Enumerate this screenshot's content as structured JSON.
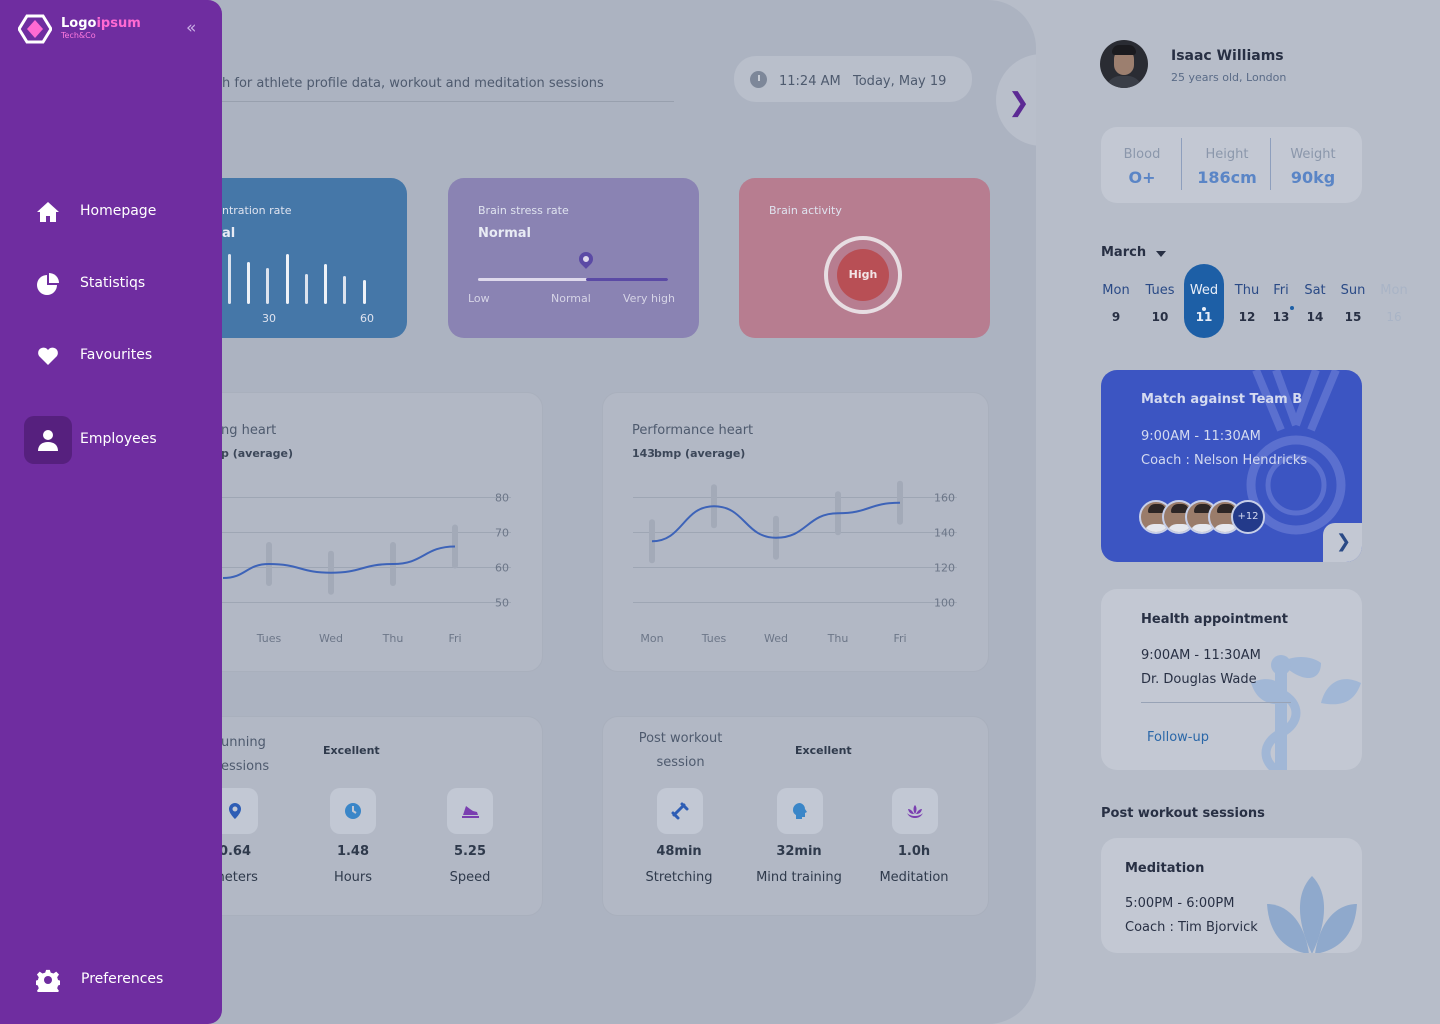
{
  "header": {
    "search_text": "h for athlete profile data, workout and meditation sessions",
    "time": "11:24 AM",
    "date": "Today, May 19"
  },
  "cards": {
    "concentration": {
      "title": "ntration rate",
      "value": "al",
      "tick_30": "30",
      "tick_60": "60"
    },
    "stress": {
      "title": "Brain stress rate",
      "value": "Normal",
      "level": 0.57,
      "low": "Low",
      "normal": "Normal",
      "high": "Very high"
    },
    "activity": {
      "title": "Brain activity",
      "value": "High"
    }
  },
  "resting_chart": {
    "title": "ng heart",
    "subtitle": "p (average)"
  },
  "performance_chart": {
    "title": "Performance heart",
    "subtitle_num": "143",
    "subtitle": "bmp (average)"
  },
  "chart_data": [
    {
      "type": "line",
      "title": "ng heart",
      "x": [
        "Tues",
        "Wed",
        "Thu",
        "Fri"
      ],
      "y_ticks": [
        "80",
        "70",
        "60",
        "50"
      ],
      "ylim": [
        45,
        85
      ],
      "series": [
        {
          "values": [
            61,
            58.5,
            61,
            66
          ]
        }
      ]
    },
    {
      "type": "line",
      "title": "Performance heart",
      "x": [
        "Mon",
        "Tues",
        "Wed",
        "Thu",
        "Fri"
      ],
      "y_ticks": [
        "160",
        "140",
        "120",
        "100"
      ],
      "ylim": [
        90,
        170
      ],
      "series": [
        {
          "values": [
            135,
            155,
            137,
            151,
            157
          ]
        }
      ]
    }
  ],
  "running": {
    "title_line1": "unning",
    "title_line2": "essions",
    "rating": "Excellent",
    "items": [
      {
        "value": "0.64",
        "label": "meters"
      },
      {
        "value": "1.48",
        "label": "Hours"
      },
      {
        "value": "5.25",
        "label": "Speed"
      }
    ]
  },
  "post_workout": {
    "title_line1": "Post workout",
    "title_line2": "session",
    "rating": "Excellent",
    "items": [
      {
        "value": "48min",
        "label": "Stretching"
      },
      {
        "value": "32min",
        "label": "Mind training"
      },
      {
        "value": "1.0h",
        "label": "Meditation"
      }
    ]
  },
  "sidebar": {
    "logo_a": "Logo",
    "logo_b": "ipsum",
    "logo_sub": "Tech&Co",
    "items": [
      {
        "label": "Homepage"
      },
      {
        "label": "Statistiqs"
      },
      {
        "label": "Favourites"
      },
      {
        "label": "Employees"
      }
    ],
    "preferences": "Preferences"
  },
  "profile": {
    "name": "Isaac Williams",
    "info": "25 years old, London",
    "blood_label": "Blood",
    "blood": "O+",
    "height_label": "Height",
    "height": "186cm",
    "weight_label": "Weight",
    "weight": "90kg"
  },
  "calendar": {
    "month": "March",
    "days": [
      {
        "name": "Mon",
        "num": "9"
      },
      {
        "name": "Tues",
        "num": "10"
      },
      {
        "name": "Wed",
        "num": "11"
      },
      {
        "name": "Thu",
        "num": "12"
      },
      {
        "name": "Fri",
        "num": "13"
      },
      {
        "name": "Sat",
        "num": "14"
      },
      {
        "name": "Sun",
        "num": "15"
      },
      {
        "name": "Mon",
        "num": "16"
      }
    ]
  },
  "match": {
    "title": "Match against Team B",
    "time": "9:00AM - 11:30AM",
    "coach": "Coach : Nelson Hendricks",
    "more": "+12"
  },
  "appointment": {
    "title": "Health appointment",
    "time": "9:00AM - 11:30AM",
    "doctor": "Dr. Douglas Wade",
    "action": "Follow-up"
  },
  "post_sessions": {
    "title": "Post workout sessions",
    "item_title": "Meditation",
    "item_time": "5:00PM - 6:00PM",
    "item_coach": "Coach : Tim Bjorvick"
  },
  "colors": {
    "sidebar": "#6f2da0",
    "accent_blue": "#1d5fa6",
    "match_card": "#3c55c2"
  }
}
